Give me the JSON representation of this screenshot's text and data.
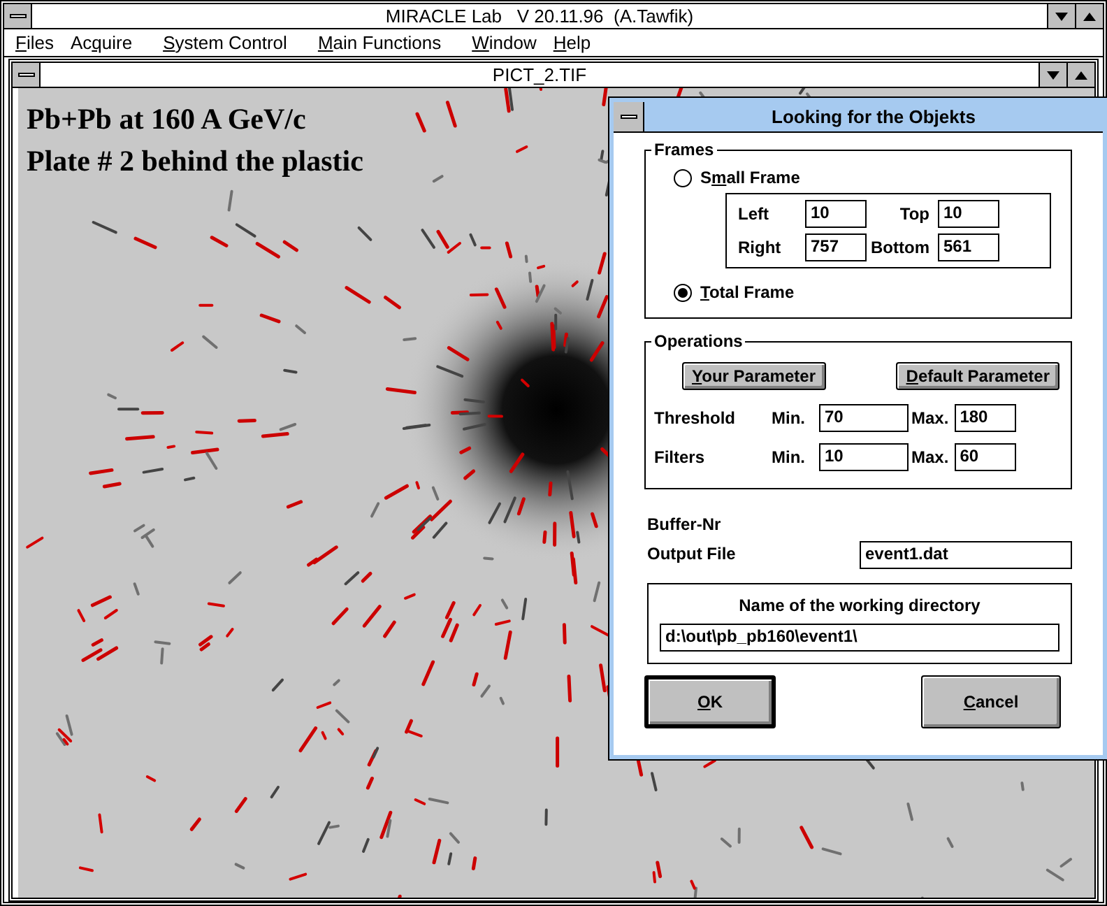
{
  "window": {
    "title": "MIRACLE Lab   V 20.11.96  (A.Tawfik)"
  },
  "menu": [
    {
      "label": "Files"
    },
    {
      "label": "Acquire"
    },
    {
      "label": "System Control"
    },
    {
      "label": "Main Functions"
    },
    {
      "label": "Window"
    },
    {
      "label": "Help"
    }
  ],
  "document": {
    "title": "PICT_2.TIF",
    "caption": [
      "Pb+Pb at 160 A GeV/c",
      "Plate # 2 behind the plastic"
    ]
  },
  "dialog": {
    "title": "Looking for the Objekts",
    "frames": {
      "label": "Frames",
      "options": [
        {
          "label": "Small Frame",
          "selected": false
        },
        {
          "label": "Total Frame",
          "selected": true
        }
      ],
      "fields": [
        {
          "label": "Left",
          "value": "10"
        },
        {
          "label": "Top",
          "value": "10"
        },
        {
          "label": "Right",
          "value": "757"
        },
        {
          "label": "Bottom",
          "value": "561"
        }
      ]
    },
    "operations": {
      "label": "Operations",
      "buttons": [
        {
          "label": "Your Parameter"
        },
        {
          "label": "Default Parameter"
        }
      ],
      "rows": [
        {
          "label": "Threshold",
          "min_label": "Min.",
          "min": "70",
          "max_label": "Max.",
          "max": "180"
        },
        {
          "label": "Filters",
          "min_label": "Min.",
          "min": "10",
          "max_label": "Max.",
          "max": "60"
        }
      ]
    },
    "buffer_label": "Buffer-Nr",
    "output_file": {
      "label": "Output File",
      "value": "event1.dat"
    },
    "working_directory": {
      "label": "Name of the working directory",
      "value": "d:\\out\\pb_pb160\\event1\\"
    },
    "buttons": [
      {
        "label": "OK",
        "default": true
      },
      {
        "label": "Cancel",
        "default": false
      }
    ]
  }
}
